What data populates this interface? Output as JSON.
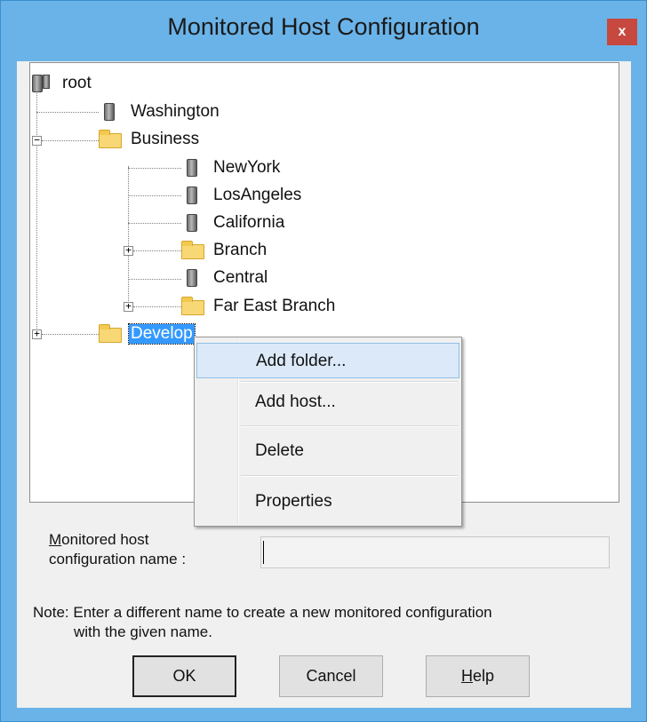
{
  "window": {
    "title": "Monitored Host Configuration",
    "close_glyph": "x"
  },
  "tree": {
    "nodes": [
      {
        "label": "root",
        "icon": "server-icon"
      },
      {
        "label": "Washington",
        "icon": "server-icon"
      },
      {
        "label": "Business",
        "icon": "folder-icon",
        "expander": "−"
      },
      {
        "label": "NewYork",
        "icon": "server-icon"
      },
      {
        "label": "LosAngeles",
        "icon": "server-icon"
      },
      {
        "label": "California",
        "icon": "server-icon"
      },
      {
        "label": "Branch",
        "icon": "folder-icon",
        "expander": "+"
      },
      {
        "label": "Central",
        "icon": "server-icon"
      },
      {
        "label": "Far East Branch",
        "icon": "folder-icon",
        "expander": "+"
      },
      {
        "label": "Develop",
        "icon": "folder-icon",
        "expander": "+",
        "selected": true
      }
    ]
  },
  "context_menu": {
    "items": [
      "Add folder...",
      "Add host...",
      "Delete",
      "Properties"
    ],
    "highlighted": "Add folder..."
  },
  "form": {
    "name_label_line1": "Monitored host",
    "name_label_line1_mnemonic": "M",
    "name_label_line1_rest": "onitored host",
    "name_label_line2": "configuration name :",
    "name_value": "",
    "note_line1": "Note: Enter a different name to create a new monitored configuration",
    "note_line2": "with the given name."
  },
  "buttons": {
    "ok": "OK",
    "cancel": "Cancel",
    "help_mnemonic": "H",
    "help_rest": "elp"
  },
  "colors": {
    "title_bar": "#6ab3e8",
    "selection": "#3399ff",
    "close": "#c7483f"
  }
}
